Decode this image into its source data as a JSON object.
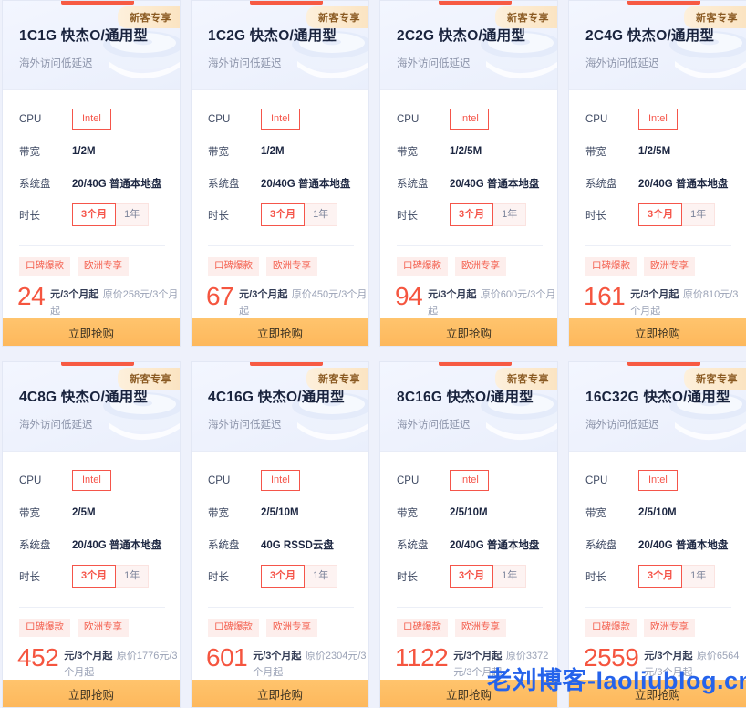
{
  "labels": {
    "cpu": "CPU",
    "bandwidth": "带宽",
    "disk": "系统盘",
    "duration": "时长",
    "ribbon": "新客专享",
    "subtitle": "海外访问低延迟",
    "buy": "立即抢购",
    "cpu_chip": "Intel",
    "duration_selected": "3个月",
    "duration_other": "1年",
    "tag1": "口碑爆款",
    "tag2": "欧洲专享",
    "price_unit": "元/3个月起"
  },
  "watermark": "老刘博客-laoliublog.cn",
  "colors": {
    "accent_red": "#f75a43",
    "price_red": "#f5553f",
    "buy_orange": "#fdb85c",
    "ribbon_gold": "#8a5a22",
    "watermark_blue": "#2563eb"
  },
  "cards": [
    {
      "title": "1C1G 快杰O/通用型",
      "bandwidth": "1/2M",
      "disk": "20/40G 普通本地盘",
      "price": "24",
      "original": "原价258元/3个月起"
    },
    {
      "title": "1C2G 快杰O/通用型",
      "bandwidth": "1/2M",
      "disk": "20/40G 普通本地盘",
      "price": "67",
      "original": "原价450元/3个月起"
    },
    {
      "title": "2C2G 快杰O/通用型",
      "bandwidth": "1/2/5M",
      "disk": "20/40G 普通本地盘",
      "price": "94",
      "original": "原价600元/3个月起"
    },
    {
      "title": "2C4G 快杰O/通用型",
      "bandwidth": "1/2/5M",
      "disk": "20/40G 普通本地盘",
      "price": "161",
      "original": "原价810元/3个月起"
    },
    {
      "title": "4C8G 快杰O/通用型",
      "bandwidth": "2/5M",
      "disk": "20/40G 普通本地盘",
      "price": "452",
      "original": "原价1776元/3个月起"
    },
    {
      "title": "4C16G 快杰O/通用型",
      "bandwidth": "2/5/10M",
      "disk": "40G RSSD云盘",
      "price": "601",
      "original": "原价2304元/3个月起"
    },
    {
      "title": "8C16G 快杰O/通用型",
      "bandwidth": "2/5/10M",
      "disk": "20/40G 普通本地盘",
      "price": "1122",
      "original": "原价3372元/3个月起"
    },
    {
      "title": "16C32G 快杰O/通用型",
      "bandwidth": "2/5/10M",
      "disk": "20/40G 普通本地盘",
      "price": "2559",
      "original": "原价6564元/3个月起"
    }
  ]
}
